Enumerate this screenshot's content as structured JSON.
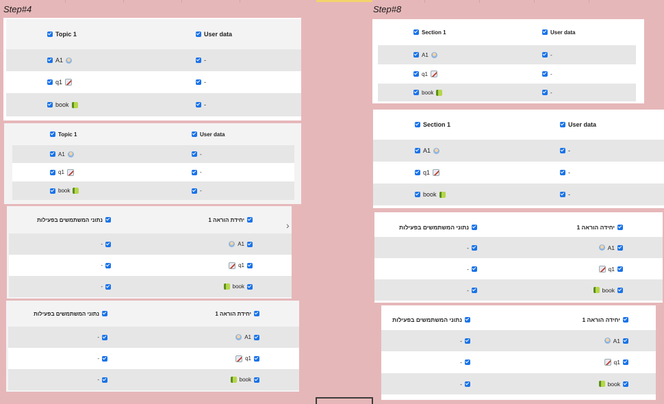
{
  "labels": {
    "step_left": "Step#4",
    "step_right": "Step#8"
  },
  "rows": {
    "header_topic": [
      "Topic 1",
      "User data"
    ],
    "header_section": [
      "Section 1",
      "User data"
    ],
    "header_rtl": [
      "יחידת הוראה 1",
      "נתוני המשתמשים בפעילות"
    ],
    "header_rtl2": [
      "יחידה הוראה 1",
      "נתוני המשתמשים בפעילות"
    ],
    "a1": [
      "A1",
      "-"
    ],
    "q1": [
      "q1",
      "-"
    ],
    "book": [
      "book",
      "-"
    ]
  },
  "icons": {
    "a1": "user-icon",
    "q1": "quiz-icon",
    "book": "book-icon"
  },
  "colors": {
    "background": "#e6b7b9",
    "checkbox": "#1a73e8",
    "row_grey": "#e6e6e6",
    "row_light": "#f3f3f4"
  }
}
